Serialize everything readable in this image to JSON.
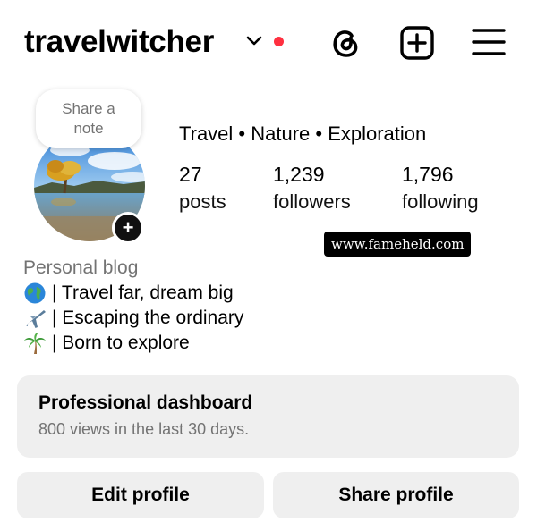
{
  "header": {
    "username": "travelwitcher",
    "icons": {
      "switch": "chevron-down-icon",
      "notification": "red-dot-badge",
      "threads": "threads-icon",
      "create": "plus-square-icon",
      "menu": "hamburger-menu-icon"
    },
    "colors": {
      "notification_dot": "#ff3040"
    }
  },
  "profile": {
    "note_bubble": "Share a note",
    "full_name": "Travel • Nature • Exploration",
    "stats": {
      "posts": {
        "count": "27",
        "label": "posts"
      },
      "followers": {
        "count": "1,239",
        "label": "followers"
      },
      "following": {
        "count": "1,796",
        "label": "following"
      }
    }
  },
  "watermark": "www.fameheld.com",
  "bio": {
    "category": "Personal blog",
    "lines": [
      {
        "icon": "globe-emoji",
        "text": "| Travel far, dream big"
      },
      {
        "icon": "airplane-emoji",
        "text": "| Escaping the ordinary"
      },
      {
        "icon": "palm-tree-emoji",
        "text": "| Born to explore"
      }
    ]
  },
  "dashboard": {
    "title": "Professional dashboard",
    "subtitle": "800 views in the last 30 days."
  },
  "actions": {
    "edit_label": "Edit profile",
    "share_label": "Share profile"
  },
  "colors": {
    "secondary_text": "#737373",
    "button_bg": "#efefef"
  }
}
